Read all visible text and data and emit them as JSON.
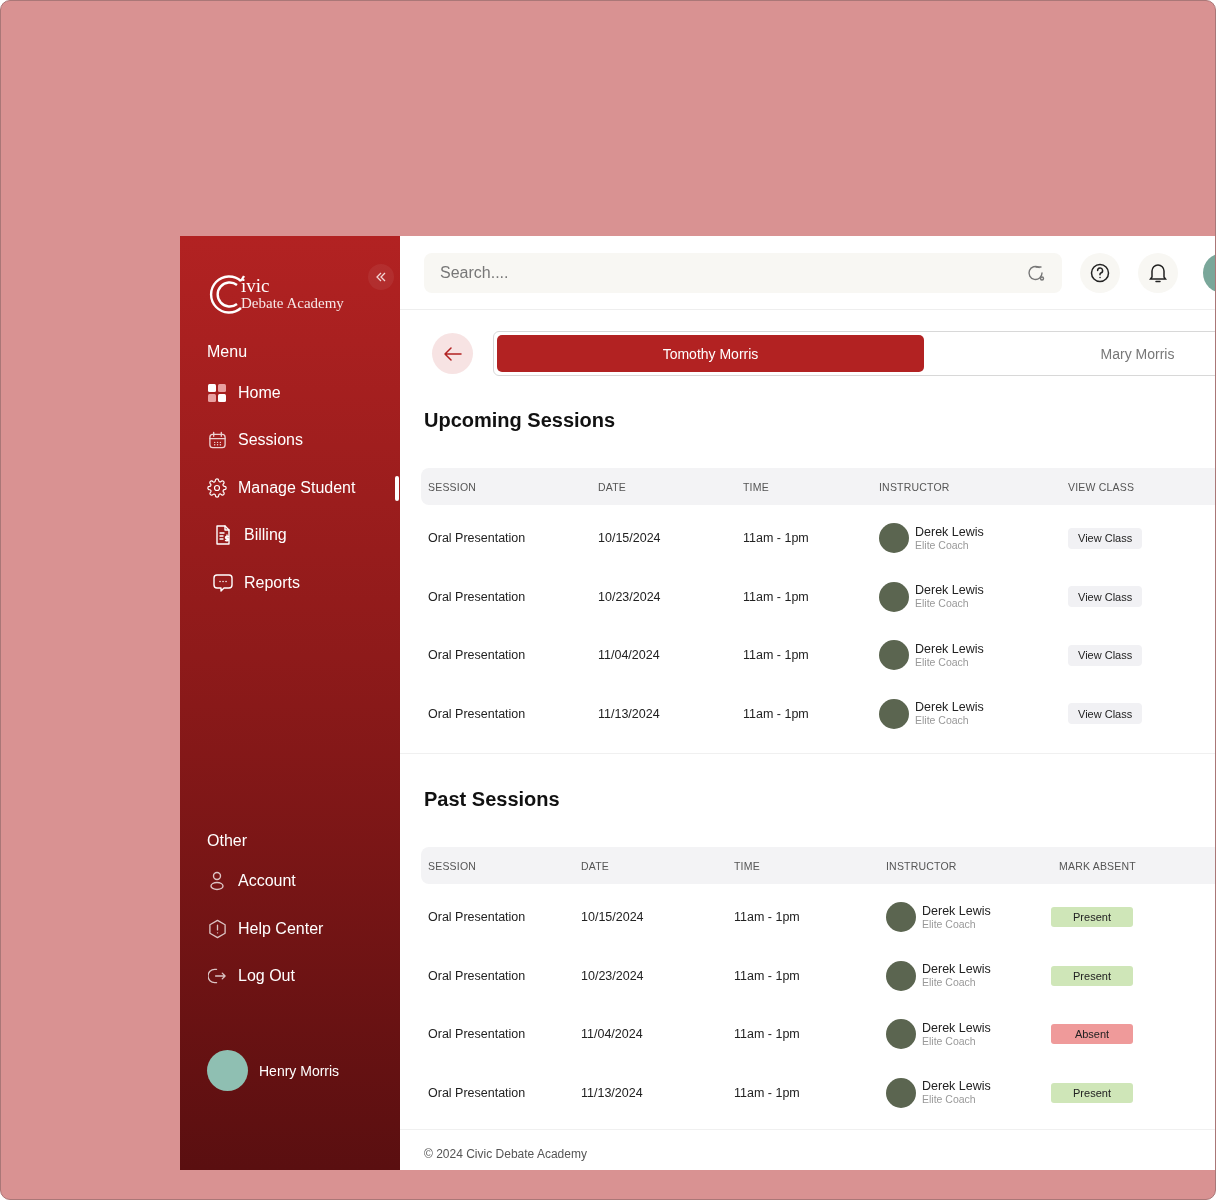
{
  "sidebar": {
    "logo": {
      "line1": "ivic",
      "line2": "Debate Academy"
    },
    "menu_heading": "Menu",
    "menu": [
      {
        "label": "Home",
        "selected": false
      },
      {
        "label": "Sessions",
        "selected": false
      },
      {
        "label": "Manage Student",
        "selected": true
      },
      {
        "label": "Billing",
        "selected": false
      },
      {
        "label": "Reports",
        "selected": false
      }
    ],
    "other_heading": "Other",
    "other": [
      {
        "label": "Account"
      },
      {
        "label": "Help Center"
      },
      {
        "label": "Log Out"
      }
    ],
    "user": {
      "name": "Henry Morris"
    }
  },
  "topbar": {
    "search": {
      "placeholder": "Search...."
    }
  },
  "student_tabs": [
    {
      "label": "Tomothy Morris",
      "selected": true
    },
    {
      "label": "Mary Morris",
      "selected": false
    }
  ],
  "upcoming": {
    "title": "Upcoming Sessions",
    "columns": [
      "SESSION",
      "DATE",
      "TIME",
      "INSTRUCTOR",
      "VIEW CLASS"
    ],
    "rows": [
      {
        "session": "Oral Presentation",
        "date": "10/15/2024",
        "time": "11am - 1pm",
        "instructor": {
          "name": "Derek Lewis",
          "role": "Elite Coach"
        },
        "action": "View Class"
      },
      {
        "session": "Oral Presentation",
        "date": "10/23/2024",
        "time": "11am - 1pm",
        "instructor": {
          "name": "Derek Lewis",
          "role": "Elite Coach"
        },
        "action": "View Class"
      },
      {
        "session": "Oral Presentation",
        "date": "11/04/2024",
        "time": "11am - 1pm",
        "instructor": {
          "name": "Derek Lewis",
          "role": "Elite Coach"
        },
        "action": "View Class"
      },
      {
        "session": "Oral Presentation",
        "date": "11/13/2024",
        "time": "11am - 1pm",
        "instructor": {
          "name": "Derek Lewis",
          "role": "Elite Coach"
        },
        "action": "View Class"
      }
    ]
  },
  "past": {
    "title": "Past Sessions",
    "columns": [
      "SESSION",
      "DATE",
      "TIME",
      "INSTRUCTOR",
      "MARK ABSENT"
    ],
    "rows": [
      {
        "session": "Oral Presentation",
        "date": "10/15/2024",
        "time": "11am - 1pm",
        "instructor": {
          "name": "Derek Lewis",
          "role": "Elite Coach"
        },
        "status": {
          "label": "Present",
          "kind": "present"
        }
      },
      {
        "session": "Oral Presentation",
        "date": "10/23/2024",
        "time": "11am - 1pm",
        "instructor": {
          "name": "Derek Lewis",
          "role": "Elite Coach"
        },
        "status": {
          "label": "Present",
          "kind": "present"
        }
      },
      {
        "session": "Oral Presentation",
        "date": "11/04/2024",
        "time": "11am - 1pm",
        "instructor": {
          "name": "Derek Lewis",
          "role": "Elite Coach"
        },
        "status": {
          "label": "Absent",
          "kind": "absent"
        }
      },
      {
        "session": "Oral Presentation",
        "date": "11/13/2024",
        "time": "11am - 1pm",
        "instructor": {
          "name": "Derek Lewis",
          "role": "Elite Coach"
        },
        "status": {
          "label": "Present",
          "kind": "present"
        }
      }
    ]
  },
  "footer": "© 2024 Civic Debate Academy"
}
